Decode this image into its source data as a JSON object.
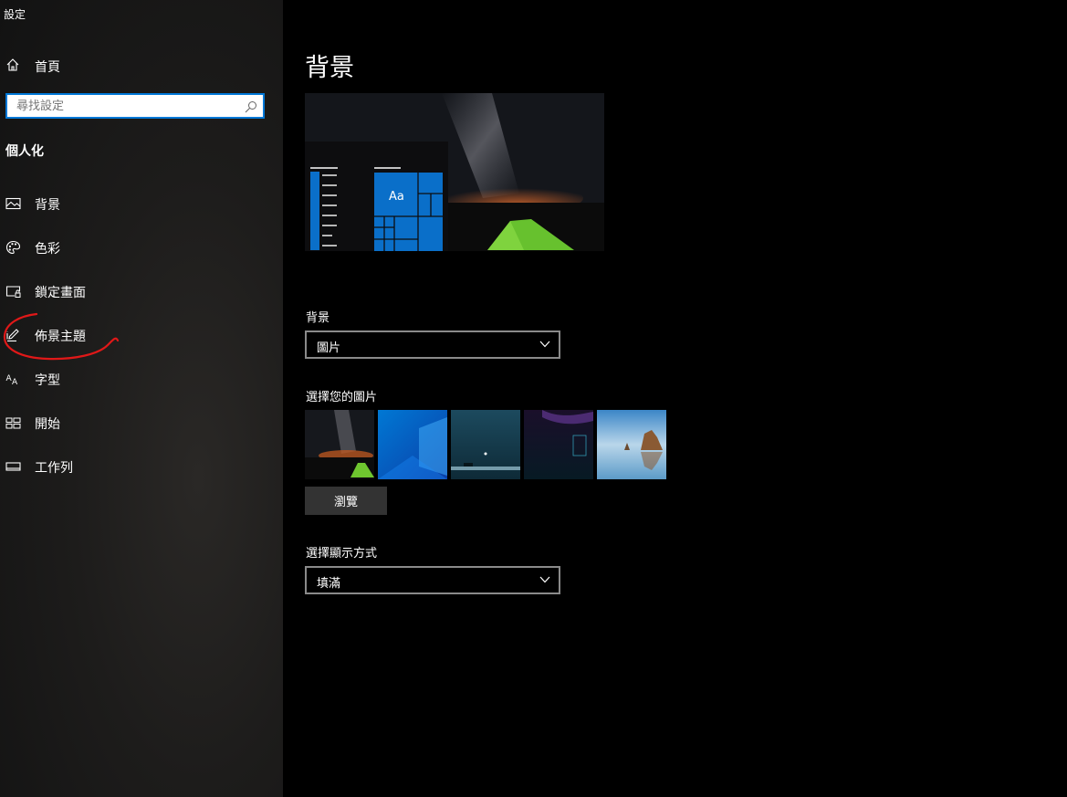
{
  "window": {
    "title": "設定"
  },
  "sidebar": {
    "home_label": "首頁",
    "search_placeholder": "尋找設定",
    "section_title": "個人化",
    "items": [
      {
        "label": "背景",
        "icon": "picture-icon"
      },
      {
        "label": "色彩",
        "icon": "palette-icon"
      },
      {
        "label": "鎖定畫面",
        "icon": "lock-screen-icon"
      },
      {
        "label": "佈景主題",
        "icon": "brush-icon"
      },
      {
        "label": "字型",
        "icon": "font-icon"
      },
      {
        "label": "開始",
        "icon": "start-icon"
      },
      {
        "label": "工作列",
        "icon": "taskbar-icon"
      }
    ]
  },
  "main": {
    "title": "背景",
    "preview": {
      "tile_text": "Aa"
    },
    "background_label": "背景",
    "background_value": "圖片",
    "choose_picture_label": "選擇您的圖片",
    "browse_label": "瀏覽",
    "fit_label": "選擇顯示方式",
    "fit_value": "填滿"
  },
  "colors": {
    "accent": "#0078d7",
    "annotation": "#e01818"
  }
}
